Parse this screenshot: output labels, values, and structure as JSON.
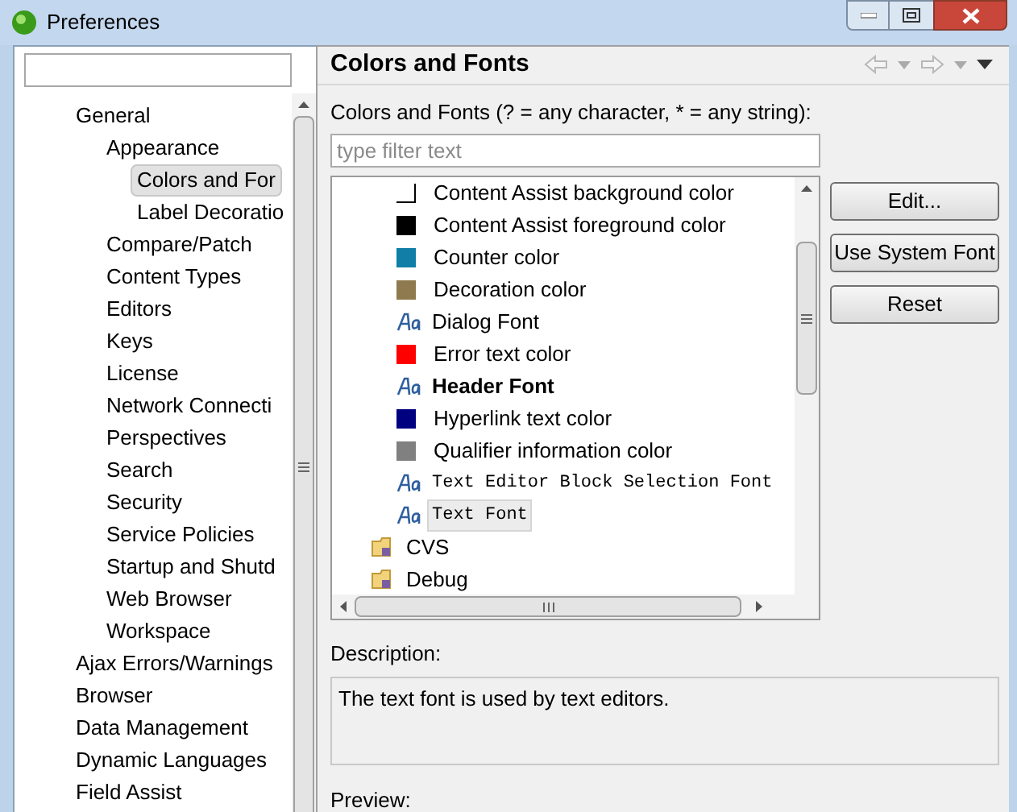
{
  "window": {
    "title": "Preferences"
  },
  "sidebar": {
    "items": [
      {
        "label": "General",
        "selected": false,
        "children": [
          {
            "label": "Appearance",
            "selected": false,
            "children": [
              {
                "label": "Colors and For",
                "selected": true
              },
              {
                "label": "Label Decoratio",
                "selected": false
              }
            ]
          },
          {
            "label": "Compare/Patch",
            "selected": false
          },
          {
            "label": "Content Types",
            "selected": false
          },
          {
            "label": "Editors",
            "selected": false
          },
          {
            "label": "Keys",
            "selected": false
          },
          {
            "label": "License",
            "selected": false
          },
          {
            "label": "Network Connecti",
            "selected": false
          },
          {
            "label": "Perspectives",
            "selected": false
          },
          {
            "label": "Search",
            "selected": false
          },
          {
            "label": "Security",
            "selected": false
          },
          {
            "label": "Service Policies",
            "selected": false
          },
          {
            "label": "Startup and Shutd",
            "selected": false
          },
          {
            "label": "Web Browser",
            "selected": false
          },
          {
            "label": "Workspace",
            "selected": false
          }
        ]
      },
      {
        "label": "Ajax Errors/Warnings",
        "selected": false
      },
      {
        "label": "Browser",
        "selected": false
      },
      {
        "label": "Data Management",
        "selected": false
      },
      {
        "label": "Dynamic Languages",
        "selected": false
      },
      {
        "label": "Field Assist",
        "selected": false
      }
    ]
  },
  "page": {
    "title": "Colors and Fonts",
    "filter_label": "Colors and Fonts (? = any character, * = any string):",
    "filter": {
      "placeholder": "type filter text"
    },
    "tree": [
      {
        "kind": "color",
        "label": "Content Assist background color",
        "color": "#ffffff",
        "selected": false
      },
      {
        "kind": "color",
        "label": "Content Assist foreground color",
        "color": "#000000",
        "selected": false
      },
      {
        "kind": "color",
        "label": "Counter color",
        "color": "#0f7fa8",
        "selected": false
      },
      {
        "kind": "color",
        "label": "Decoration color",
        "color": "#8f7a4f",
        "selected": false
      },
      {
        "kind": "font",
        "label": "Dialog Font",
        "selected": false
      },
      {
        "kind": "color",
        "label": "Error text color",
        "color": "#ff0000",
        "selected": false
      },
      {
        "kind": "boldfont",
        "label": "Header Font",
        "selected": false
      },
      {
        "kind": "color",
        "label": "Hyperlink text color",
        "color": "#000080",
        "selected": false
      },
      {
        "kind": "color",
        "label": "Qualifier information color",
        "color": "#808080",
        "selected": false
      },
      {
        "kind": "monofont",
        "label": "Text Editor Block Selection Font",
        "selected": false
      },
      {
        "kind": "monofont",
        "label": "Text Font",
        "selected": true
      },
      {
        "kind": "category",
        "label": "CVS",
        "selected": false
      },
      {
        "kind": "category",
        "label": "Debug",
        "selected": false
      }
    ],
    "buttons": [
      "Edit...",
      "Use System Font",
      "Reset"
    ],
    "description_label": "Description:",
    "description": "The text font is used by text editors.",
    "preview_label": "Preview:"
  }
}
